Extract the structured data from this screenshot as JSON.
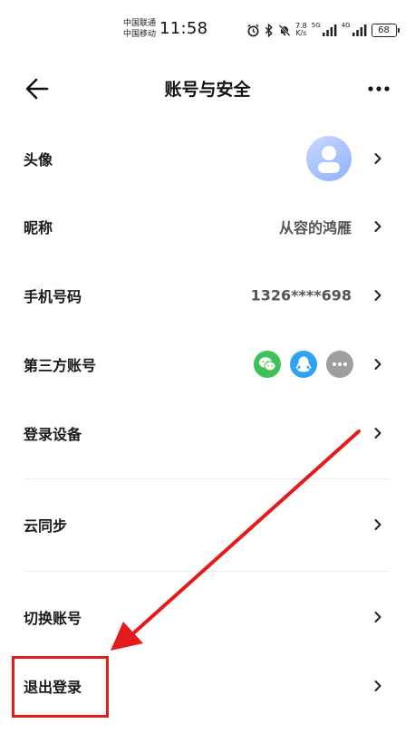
{
  "status_bar": {
    "carrier_1": "中国联通",
    "carrier_2": "中国移动",
    "time": "11:58",
    "speed_value": "7.8",
    "speed_unit": "K/s",
    "net_1": "5G",
    "net_2": "4G",
    "battery": "68"
  },
  "header": {
    "title": "账号与安全",
    "back_icon": "arrow-left-icon",
    "more_icon": "more-dots-icon"
  },
  "rows": {
    "avatar": {
      "label": "头像"
    },
    "nickname": {
      "label": "昵称",
      "value": "从容的鸿雁"
    },
    "phone": {
      "label": "手机号码",
      "value": "1326****698"
    },
    "third_party": {
      "label": "第三方账号"
    },
    "devices": {
      "label": "登录设备"
    },
    "cloud_sync": {
      "label": "云同步"
    },
    "switch_account": {
      "label": "切换账号"
    },
    "logout": {
      "label": "退出登录"
    }
  },
  "colors": {
    "wechat": "#3fc15a",
    "qq": "#2ea3f2",
    "more_accounts": "#9e9e9e",
    "annotation": "#e31b1b"
  }
}
